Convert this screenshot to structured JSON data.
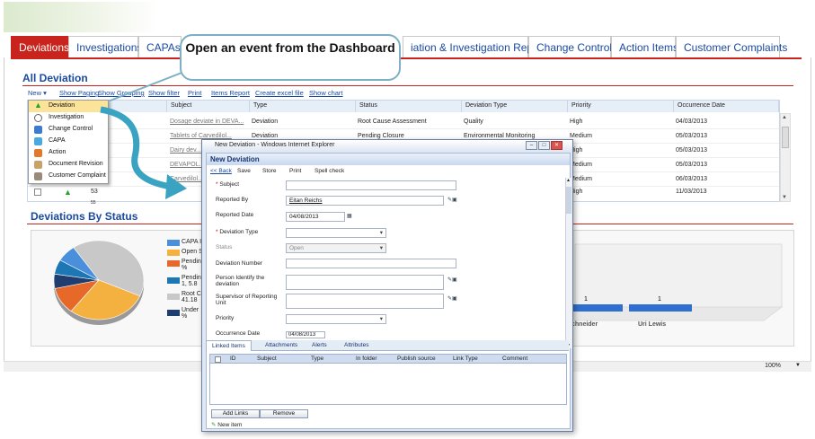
{
  "tabs": [
    {
      "label": "Deviations"
    },
    {
      "label": "Investigations"
    },
    {
      "label": "CAPAs"
    },
    {
      "label": "iation & Investigation Report"
    },
    {
      "label": "Change Controls"
    },
    {
      "label": "Action Items"
    },
    {
      "label": "Customer Complaints"
    }
  ],
  "section_title": "All Deviation",
  "toolbar": {
    "new": "New ▾",
    "show_paging": "Show Paging",
    "show_grouping": "Show Grouping",
    "show_filter": "Show filter",
    "print": "Print",
    "items_report": "Items Report",
    "create_excel": "Create excel file",
    "show_chart": "Show chart"
  },
  "grid": {
    "columns": [
      "Subject",
      "Type",
      "Status",
      "Deviation Type",
      "Priority",
      "Occurrence Date"
    ],
    "rows": [
      {
        "subject": "Dosage deviate in DEVA...",
        "type": "Deviation",
        "status": "Root Cause Assessment",
        "dev_type": "Quality",
        "priority": "High",
        "date": "04/03/2013"
      },
      {
        "subject": "Tablets of Carvedilol...",
        "type": "Deviation",
        "status": "Pending Closure",
        "dev_type": "Environmental Monitoring",
        "priority": "Medium",
        "date": "05/03/2013"
      },
      {
        "subject": "Dairy dev...",
        "type": "",
        "status": "",
        "dev_type": "",
        "priority": "High",
        "date": "05/03/2013"
      },
      {
        "subject": "DEVAPOL...",
        "type": "",
        "status": "",
        "dev_type": "",
        "priority": "Medium",
        "date": "05/03/2013"
      },
      {
        "subject": "Carvedilol...",
        "type": "",
        "status": "",
        "dev_type": "",
        "priority": "Medium",
        "date": "06/03/2013"
      },
      {
        "subject": "",
        "type": "",
        "status": "",
        "dev_type": "",
        "priority": "High",
        "date": "11/03/2013"
      }
    ],
    "row_num": "53",
    "row_num2": "55"
  },
  "new_menu": [
    "Deviation",
    "Investigation",
    "Change Control",
    "CAPA",
    "Action",
    "Document Revision",
    "Customer Complaint"
  ],
  "callout": "Open an event from the Dashboard",
  "status_section": {
    "title": "Deviations By Status",
    "legend": [
      "CAPA I",
      "Open S",
      "Pendin %",
      "Pendin 1, 5.8",
      "Root C 41.18",
      "Under %"
    ],
    "bar_labels": [
      "1",
      "1"
    ],
    "bar_names": [
      "chneider",
      "Uri Lewis"
    ]
  },
  "pie": [
    {
      "value": 41.18,
      "color": "#c8c8c8"
    },
    {
      "value": 29,
      "color": "#f5b140"
    },
    {
      "value": 11,
      "color": "#e6692a"
    },
    {
      "value": 5.88,
      "color": "#1f3e6f"
    },
    {
      "value": 6,
      "color": "#1e77b5"
    },
    {
      "value": 7,
      "color": "#4a8fdc"
    }
  ],
  "popup": {
    "window_title": "New Deviation - Windows Internet Explorer",
    "header": "New Deviation",
    "toolbar": {
      "back": "<< Back",
      "save": "Save",
      "store": "Store",
      "print": "Print",
      "spell": "Spell check"
    },
    "fields": {
      "subject": "Subject",
      "reported_by": "Reported By",
      "reported_by_value": "Eitan Reichs",
      "reported_date": "Reported Date",
      "reported_date_value": "04/08/2013",
      "deviation_type": "Deviation Type",
      "status": "Status",
      "status_value": "Open",
      "deviation_number": "Deviation Number",
      "person_identify": "Person Identify the deviation",
      "supervisor": "Supervisor of Reporting Unit",
      "priority": "Priority",
      "occurrence_date": "Occurrence Date",
      "occurrence_date_value": "04/08/2013"
    },
    "tabs": [
      "Linked Items",
      "Attachments",
      "Alerts",
      "Attributes"
    ],
    "link_columns": [
      "ID",
      "Subject",
      "Type",
      "In folder",
      "Publish source",
      "Link Type",
      "Comment"
    ],
    "add_links": "Add Links",
    "remove": "Remove",
    "new_item": "New item"
  },
  "zoom": "100%"
}
